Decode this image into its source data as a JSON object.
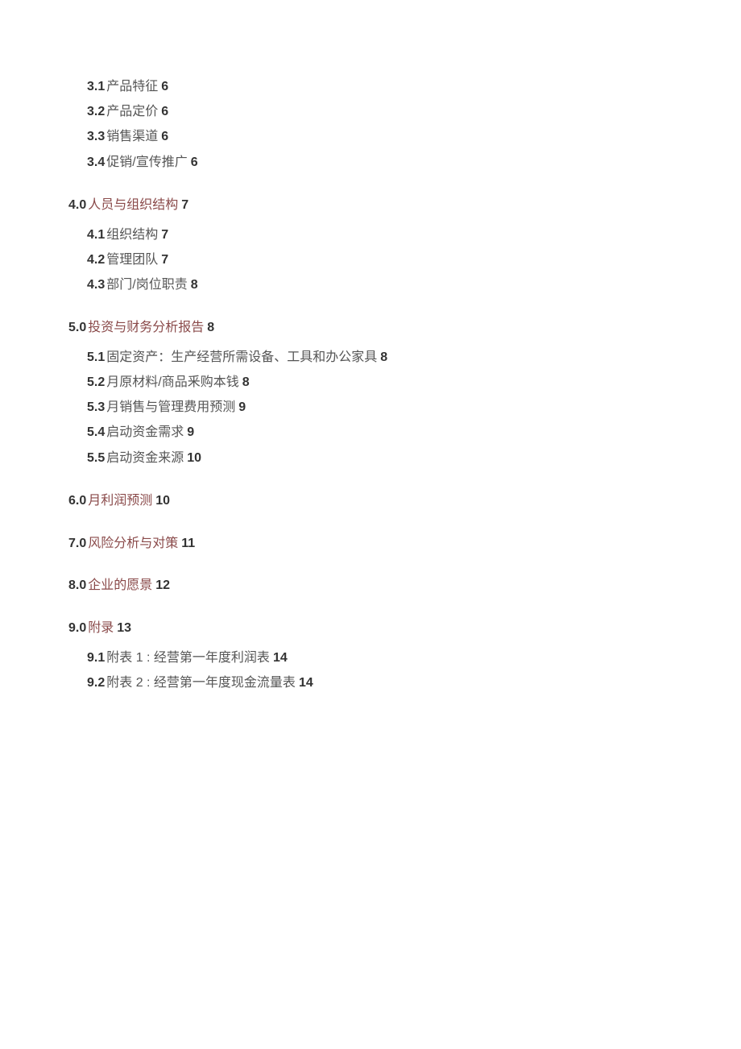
{
  "toc": [
    {
      "level": 2,
      "num": "3.1",
      "title": "产品特征",
      "page": "6",
      "section": 0
    },
    {
      "level": 2,
      "num": "3.2",
      "title": "产品定价",
      "page": "6",
      "section": 0
    },
    {
      "level": 2,
      "num": "3.3",
      "title": "销售渠道",
      "page": "6",
      "section": 0
    },
    {
      "level": 2,
      "num": "3.4",
      "title": "促销/宣传推广",
      "page": "6",
      "section": 0
    },
    {
      "level": 1,
      "num": "4.0",
      "title": "人员与组织结构",
      "page": "7",
      "section": 1
    },
    {
      "level": 2,
      "num": "4.1",
      "title": "组织结构",
      "page": "7",
      "section": 1
    },
    {
      "level": 2,
      "num": "4.2",
      "title": "管理团队",
      "page": "7",
      "section": 1
    },
    {
      "level": 2,
      "num": "4.3",
      "title": "部门/岗位职责",
      "page": "8",
      "section": 1
    },
    {
      "level": 1,
      "num": "5.0",
      "title": "投资与财务分析报告",
      "page": "8",
      "section": 2
    },
    {
      "level": 2,
      "num": "5.1",
      "title": "固定资产：生产经营所需设备、工具和办公家具",
      "page": "8",
      "section": 2
    },
    {
      "level": 2,
      "num": "5.2",
      "title": "月原材料/商品釆购本钱",
      "page": "8",
      "section": 2
    },
    {
      "level": 2,
      "num": "5.3",
      "title": "月销售与管理费用预测",
      "page": "9",
      "section": 2
    },
    {
      "level": 2,
      "num": "5.4",
      "title": "启动资金需求",
      "page": "9",
      "section": 2
    },
    {
      "level": 2,
      "num": "5.5",
      "title": "启动资金来源",
      "page": "10",
      "section": 2
    },
    {
      "level": 1,
      "num": "6.0",
      "title": "月利润预测",
      "page": "10",
      "section": 3
    },
    {
      "level": 1,
      "num": "7.0",
      "title": "风险分析与对策",
      "page": "11",
      "section": 4
    },
    {
      "level": 1,
      "num": "8.0",
      "title": "企业的愿景",
      "page": "12",
      "section": 5
    },
    {
      "level": 1,
      "num": "9.0",
      "title": "附录",
      "page": "13",
      "section": 6
    },
    {
      "level": 2,
      "num": "9.1",
      "title": "附表 1 : 经营第一年度利润表",
      "page": "14",
      "section": 6
    },
    {
      "level": 2,
      "num": "9.2",
      "title": "附表 2 : 经营第一年度现金流量表",
      "page": "14",
      "section": 6
    }
  ]
}
